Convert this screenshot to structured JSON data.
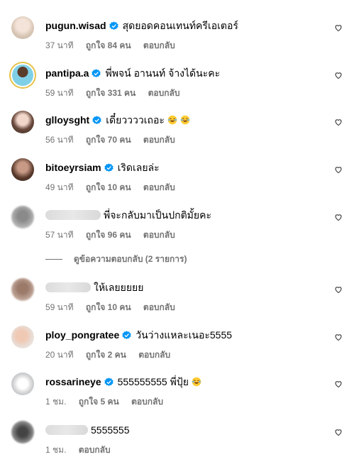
{
  "reply_label": "ตอบกลับ",
  "view_replies": "ดูข้อความตอบกลับ (2 รายการ)",
  "colors": {
    "verified": "#0095f6",
    "muted": "#737373"
  },
  "comments": [
    {
      "username": "pugun.wisad",
      "verified": true,
      "text": "สุดยอดคอนเทนท์ครีเอเตอร์",
      "time": "37 นาที",
      "likes": "ถูกใจ 84 คน"
    },
    {
      "username": "pantipa.a",
      "verified": true,
      "text": "พี่พจน์ อานนท์ จ้างได้นะคะ",
      "time": "59 นาที",
      "likes": "ถูกใจ 331 คน"
    },
    {
      "username": "glloysght",
      "verified": true,
      "text": "เดี๋ยววววเถอะ",
      "time": "56 นาที",
      "likes": "ถูกใจ 70 คน"
    },
    {
      "username": "bitoeyrsiam",
      "verified": true,
      "text": "เริดเลยล่ะ",
      "time": "49 นาที",
      "likes": "ถูกใจ 10 คน"
    },
    {
      "username": "",
      "verified": false,
      "text": "พี่จะกลับมาเป็นปกติมั้ยคะ",
      "time": "57 นาที",
      "likes": "ถูกใจ 96 คน"
    },
    {
      "username": "",
      "verified": false,
      "text": "ให้เลยยยยย",
      "time": "59 นาที",
      "likes": "ถูกใจ 10 คน"
    },
    {
      "username": "ploy_pongratee",
      "verified": true,
      "text": "วันว่างแหละเนอะ5555",
      "time": "20 นาที",
      "likes": "ถูกใจ 2 คน"
    },
    {
      "username": "rossarineye",
      "verified": true,
      "text": "555555555 พี่ปุ้ย",
      "time": "1 ชม.",
      "likes": "ถูกใจ 5 คน"
    },
    {
      "username": "",
      "verified": false,
      "text": "5555555",
      "time": "1 ชม.",
      "likes": ""
    }
  ]
}
